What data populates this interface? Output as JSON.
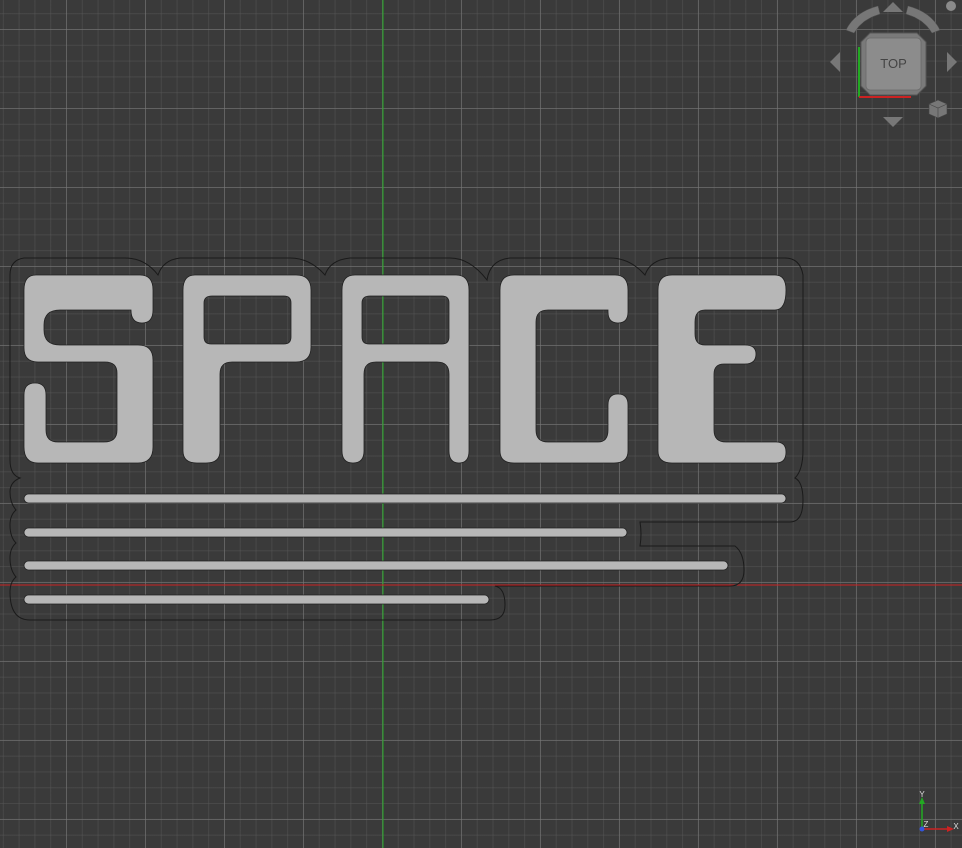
{
  "viewport": {
    "background_color": "#3a3a3a",
    "grid_color": "#5a5a5a",
    "x_axis_color": "#cc2222",
    "y_axis_color": "#22aa22",
    "model_fill_color": "#b7b7b7"
  },
  "model": {
    "text": "SPACE",
    "speed_lines": 4
  },
  "navcube": {
    "face_label": "TOP",
    "icons": [
      "rotate-left-icon",
      "rotate-right-icon",
      "arrow-up-icon",
      "arrow-down-icon",
      "arrow-left-icon",
      "arrow-right-icon",
      "view-menu-icon",
      "iso-cube-icon"
    ]
  },
  "axis_indicator": {
    "x_label": "X",
    "y_label": "Y",
    "z_label": "Z"
  }
}
